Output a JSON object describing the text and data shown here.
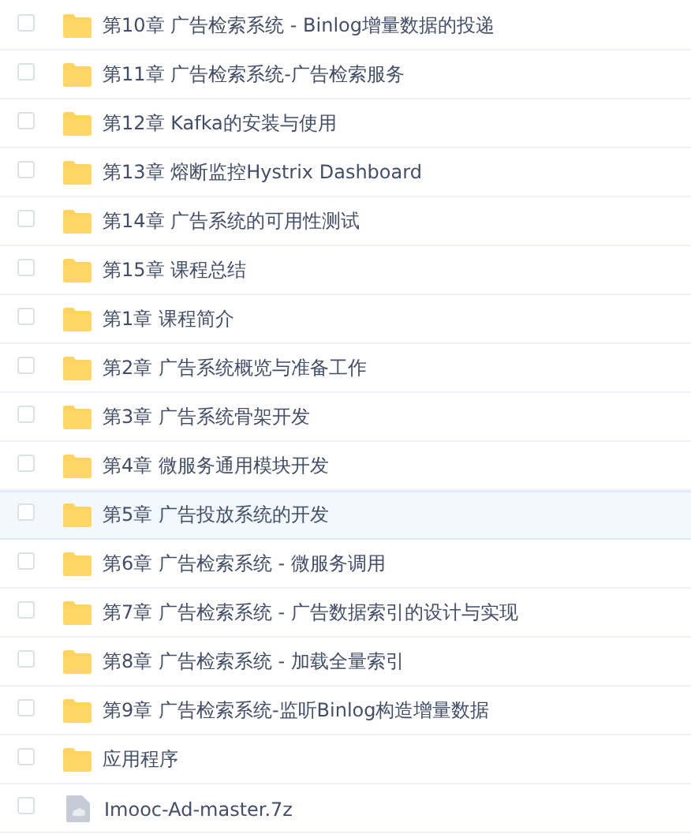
{
  "files": [
    {
      "name": "第10章 广告检索系统 - Binlog增量数据的投递",
      "kind": "folder",
      "checked": false,
      "selected": false
    },
    {
      "name": "第11章 广告检索系统-广告检索服务",
      "kind": "folder",
      "checked": false,
      "selected": false
    },
    {
      "name": "第12章 Kafka的安装与使用",
      "kind": "folder",
      "checked": false,
      "selected": false
    },
    {
      "name": "第13章 熔断监控Hystrix Dashboard",
      "kind": "folder",
      "checked": false,
      "selected": false
    },
    {
      "name": "第14章 广告系统的可用性测试",
      "kind": "folder",
      "checked": false,
      "selected": false
    },
    {
      "name": "第15章 课程总结",
      "kind": "folder",
      "checked": false,
      "selected": false
    },
    {
      "name": "第1章 课程简介",
      "kind": "folder",
      "checked": false,
      "selected": false
    },
    {
      "name": "第2章 广告系统概览与准备工作",
      "kind": "folder",
      "checked": false,
      "selected": false
    },
    {
      "name": "第3章 广告系统骨架开发",
      "kind": "folder",
      "checked": false,
      "selected": false
    },
    {
      "name": "第4章 微服务通用模块开发",
      "kind": "folder",
      "checked": false,
      "selected": false
    },
    {
      "name": "第5章 广告投放系统的开发",
      "kind": "folder",
      "checked": false,
      "selected": true
    },
    {
      "name": "第6章 广告检索系统 - 微服务调用",
      "kind": "folder",
      "checked": false,
      "selected": false
    },
    {
      "name": "第7章 广告检索系统 - 广告数据索引的设计与实现",
      "kind": "folder",
      "checked": false,
      "selected": false
    },
    {
      "name": "第8章 广告检索系统 - 加载全量索引",
      "kind": "folder",
      "checked": false,
      "selected": false
    },
    {
      "name": "第9章 广告检索系统-监听Binlog构造增量数据",
      "kind": "folder",
      "checked": false,
      "selected": false
    },
    {
      "name": "应用程序",
      "kind": "folder",
      "checked": false,
      "selected": false
    },
    {
      "name": "Imooc-Ad-master.7z",
      "kind": "file",
      "checked": false,
      "selected": false
    }
  ]
}
